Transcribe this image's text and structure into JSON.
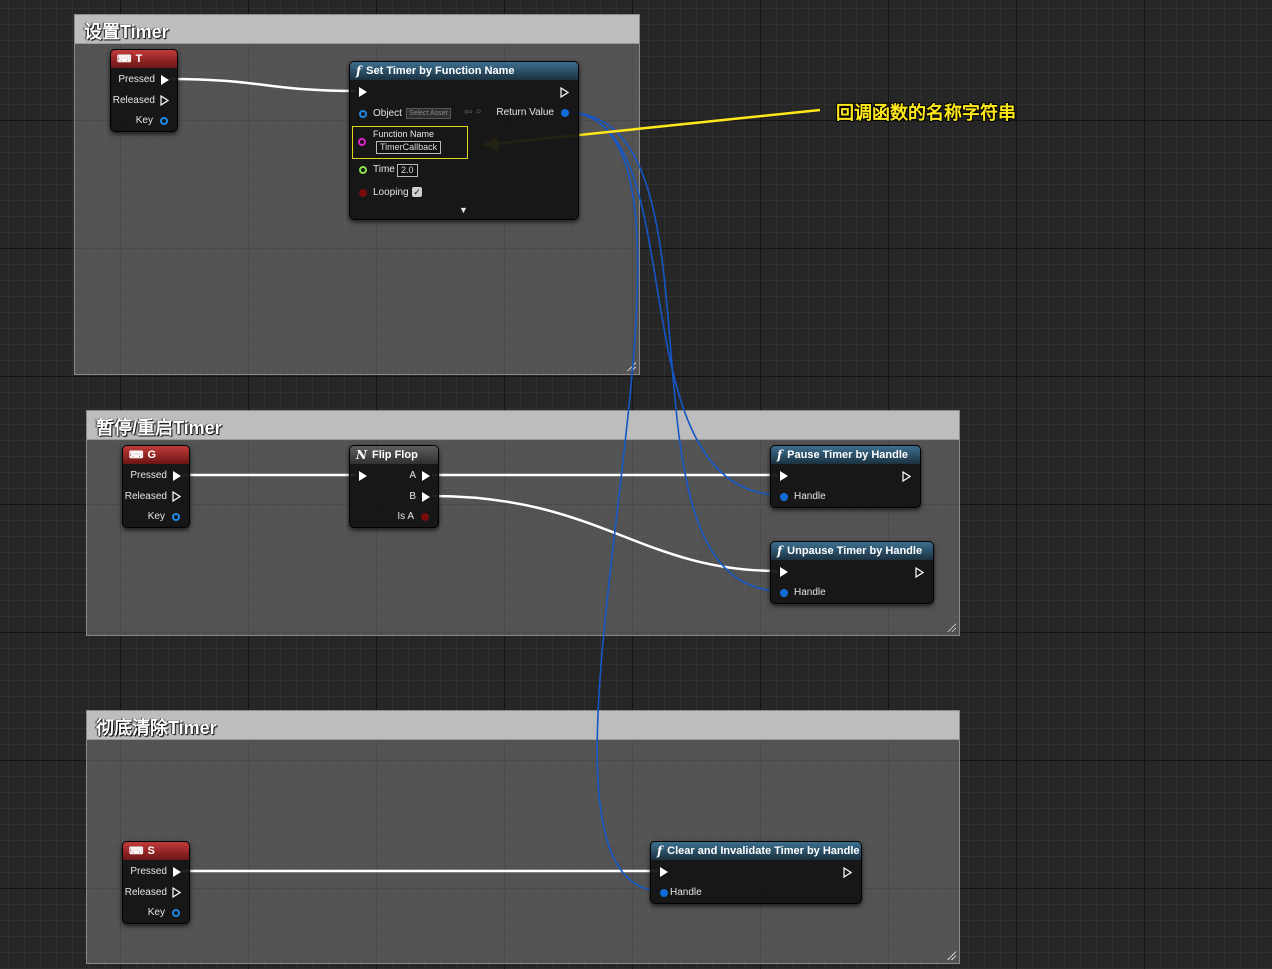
{
  "comments": {
    "set_timer": "设置Timer",
    "pause_resume": "暂停/重启Timer",
    "clear": "彻底清除Timer"
  },
  "annotation": "回调函数的名称字符串",
  "pins": {
    "pressed": "Pressed",
    "released": "Released",
    "key": "Key",
    "handle": "Handle"
  },
  "nodes": {
    "key_t": {
      "title": "T"
    },
    "key_g": {
      "title": "G"
    },
    "key_s": {
      "title": "S"
    },
    "set_timer": {
      "title": "Set Timer by Function Name",
      "object_label": "Object",
      "select_asset": "Select Asset",
      "return_value": "Return Value",
      "function_name_label": "Function Name",
      "function_name_value": "TimerCallback",
      "time_label": "Time",
      "time_value": "2.0",
      "looping_label": "Looping",
      "looping_checked": true
    },
    "flip_flop": {
      "title": "Flip Flop",
      "a": "A",
      "b": "B",
      "is_a": "Is A"
    },
    "pause": {
      "title": "Pause Timer by Handle"
    },
    "unpause": {
      "title": "Unpause Timer by Handle"
    },
    "clear": {
      "title": "Clear and Invalidate Timer by Handle"
    }
  },
  "colors": {
    "exec_wire": "#ffffff",
    "handle_wire": "#1457c8",
    "annotation": "#ffe81a",
    "key_header": "#b23030",
    "function_header": "#2f5b77"
  }
}
